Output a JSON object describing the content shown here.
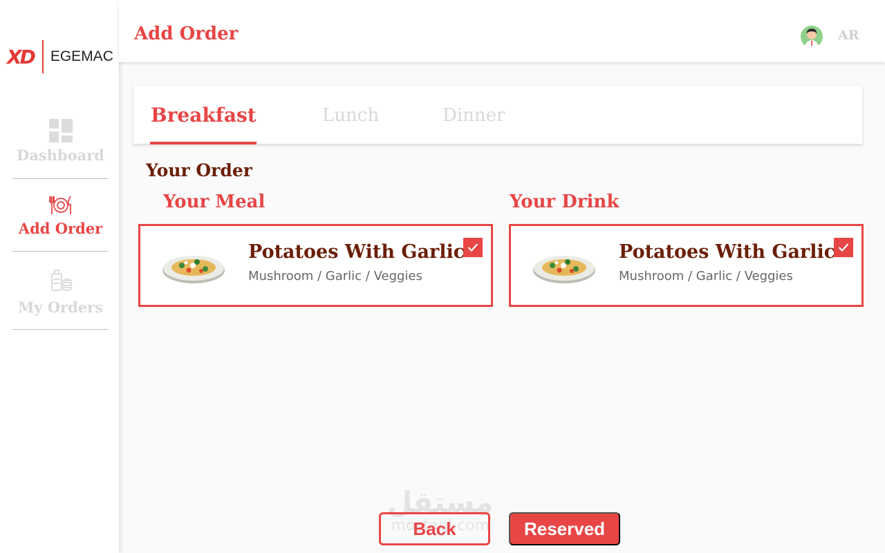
{
  "app": {
    "logo_mark": "XD",
    "logo_text": "EGEMAC"
  },
  "sidebar": {
    "items": [
      {
        "label": "Dashboard",
        "icon": "dashboard-icon",
        "active": false
      },
      {
        "label": "Add Order",
        "icon": "utensils-plate-icon",
        "active": true
      },
      {
        "label": "My Orders",
        "icon": "orders-icon",
        "active": false
      }
    ]
  },
  "header": {
    "title": "Add Order",
    "avatar_icon": "user-avatar-icon",
    "language": "AR"
  },
  "tabs": [
    {
      "label": "Breakfast",
      "active": true
    },
    {
      "label": "Lunch",
      "active": false
    },
    {
      "label": "Dinner",
      "active": false
    }
  ],
  "order": {
    "heading": "Your Order",
    "meal": {
      "section_label": "Your Meal",
      "title": "Potatoes With Garlic",
      "description": "Mushroom / Garlic / Veggies",
      "selected": true,
      "image_icon": "pasta-plate-icon"
    },
    "drink": {
      "section_label": "Your Drink",
      "title": "Potatoes With Garlic",
      "description": "Mushroom / Garlic / Veggies",
      "selected": true,
      "image_icon": "pasta-plate-icon"
    }
  },
  "actions": {
    "back_label": "Back",
    "reserved_label": "Reserved"
  },
  "watermark": {
    "arabic": "مستقل",
    "latin": "mostaql.com"
  },
  "colors": {
    "accent": "#e84545",
    "heading": "#6b1e05",
    "muted": "#d8d8d8"
  }
}
